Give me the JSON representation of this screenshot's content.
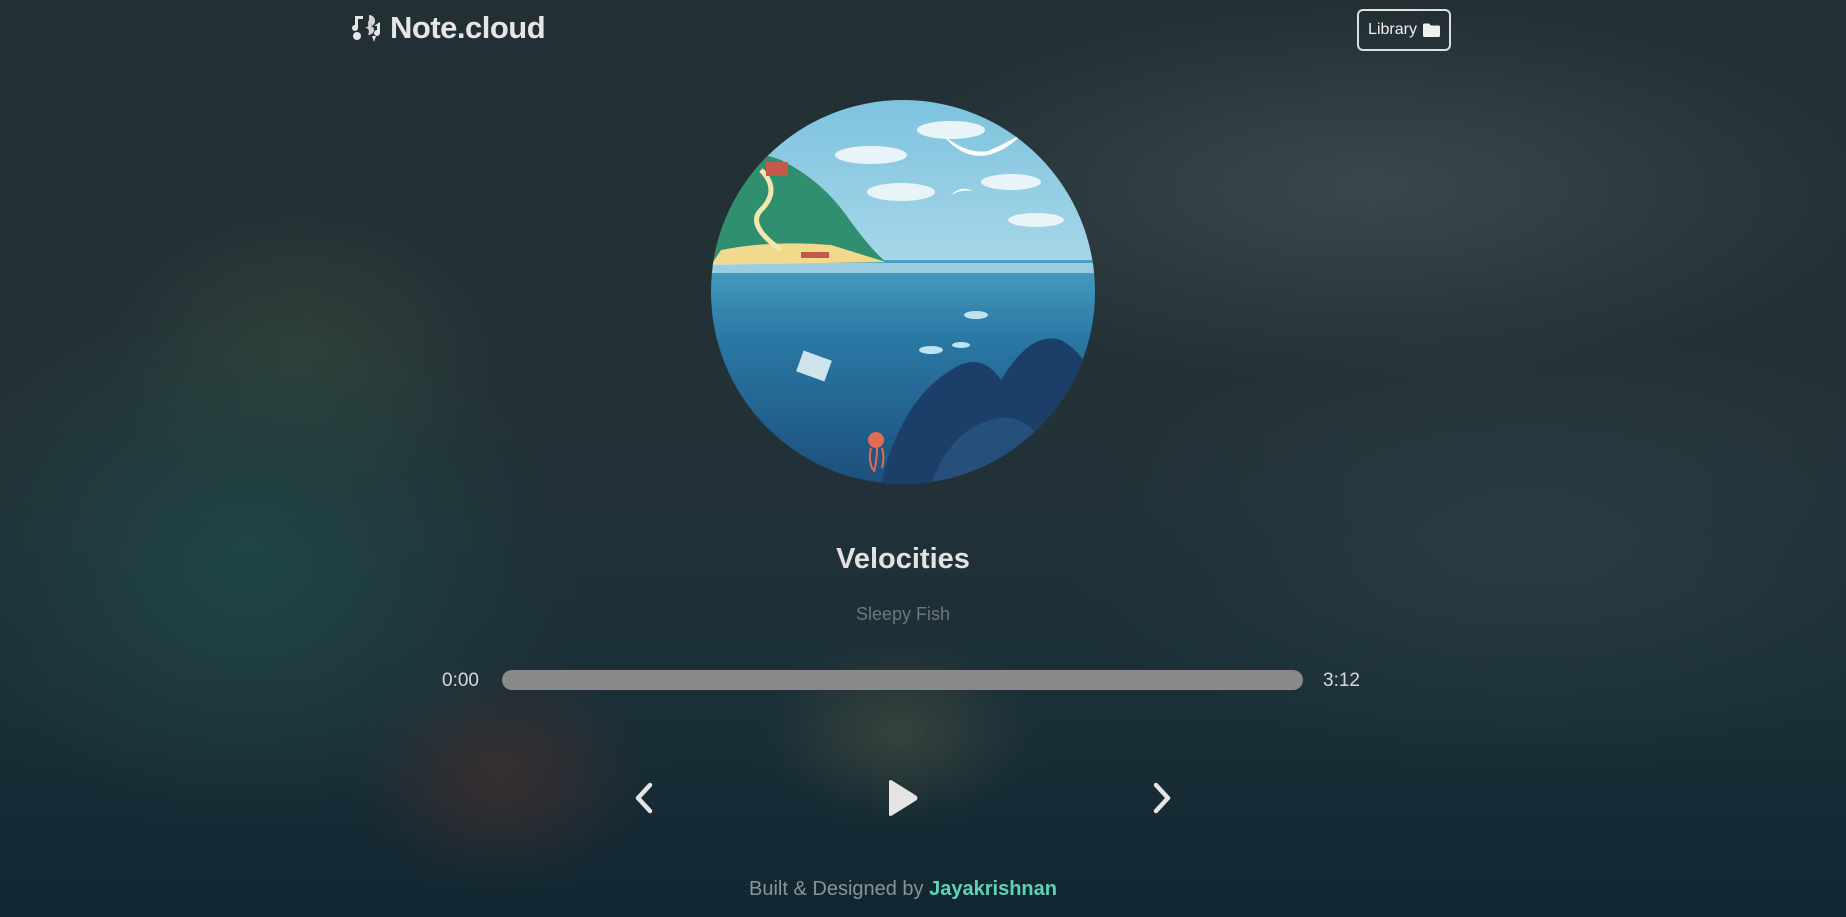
{
  "app": {
    "name": "Note.cloud"
  },
  "header": {
    "library_label": "Library"
  },
  "player": {
    "title": "Velocities",
    "artist": "Sleepy Fish",
    "current_time": "0:00",
    "total_time": "3:12",
    "progress": 0
  },
  "icons": {
    "logo": "music-notes-icon",
    "library": "folder-icon",
    "prev": "chevron-left-icon",
    "play": "play-icon",
    "next": "chevron-right-icon"
  },
  "footer": {
    "prefix": "Built & Designed by",
    "author": "Jayakrishnan"
  },
  "colors": {
    "accent": "#5fd3b8",
    "progress_track": "#8a8a8a"
  }
}
